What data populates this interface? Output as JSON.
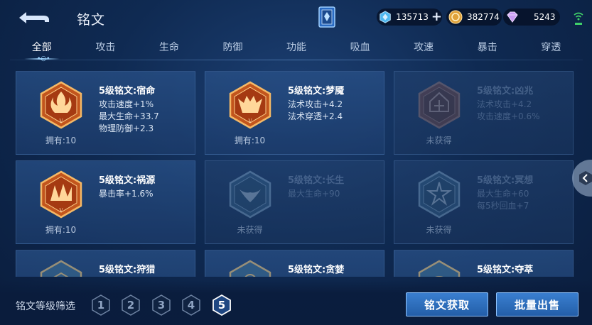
{
  "header": {
    "title": "铭文",
    "resources": {
      "diamond": "135713",
      "gold": "382774",
      "gem": "5243"
    },
    "colors": {
      "diamond": "#4fb8f0",
      "gold": "#e0a23a",
      "gem": "#c99cf5",
      "signal": "#3fd06a"
    }
  },
  "tabs": [
    "全部",
    "攻击",
    "生命",
    "防御",
    "功能",
    "吸血",
    "攻速",
    "暴击",
    "穿透"
  ],
  "active_tab": 0,
  "cards": [
    {
      "name": "5级铭文:宿命",
      "stats": [
        "攻击速度+1%",
        "最大生命+33.7",
        "物理防御+2.3"
      ],
      "owned": "拥有:10",
      "locked": false,
      "icon": "fate-rune-icon"
    },
    {
      "name": "5级铭文:梦魇",
      "stats": [
        "法术攻击+4.2",
        "法术穿透+2.4"
      ],
      "owned": "拥有:10",
      "locked": false,
      "icon": "nightmare-rune-icon"
    },
    {
      "name": "5级铭文:凶兆",
      "stats": [
        "法术攻击+4.2",
        "攻击速度+0.6%"
      ],
      "owned": "未获得",
      "locked": true,
      "icon": "omen-rune-icon"
    },
    {
      "name": "5级铭文:祸源",
      "stats": [
        "暴击率+1.6%"
      ],
      "owned": "拥有:10",
      "locked": false,
      "icon": "calamity-rune-icon"
    },
    {
      "name": "5级铭文:长生",
      "stats": [
        "最大生命+90"
      ],
      "owned": "未获得",
      "locked": true,
      "icon": "longevity-rune-icon"
    },
    {
      "name": "5级铭文:冥想",
      "stats": [
        "最大生命+60",
        "每5秒回血+7"
      ],
      "owned": "未获得",
      "locked": true,
      "icon": "meditation-rune-icon"
    },
    {
      "name": "5级铭文:狩猎",
      "stats": [],
      "owned": "",
      "locked": false,
      "icon": "hunt-rune-icon"
    },
    {
      "name": "5级铭文:贪婪",
      "stats": [],
      "owned": "",
      "locked": false,
      "icon": "greed-rune-icon"
    },
    {
      "name": "5级铭文:夺萃",
      "stats": [],
      "owned": "",
      "locked": false,
      "icon": "seize-rune-icon"
    }
  ],
  "footer": {
    "filter_label": "铭文等级筛选",
    "levels": [
      "1",
      "2",
      "3",
      "4",
      "5"
    ],
    "active_level": "5",
    "get_button": "铭文获取",
    "sell_button": "批量出售"
  }
}
